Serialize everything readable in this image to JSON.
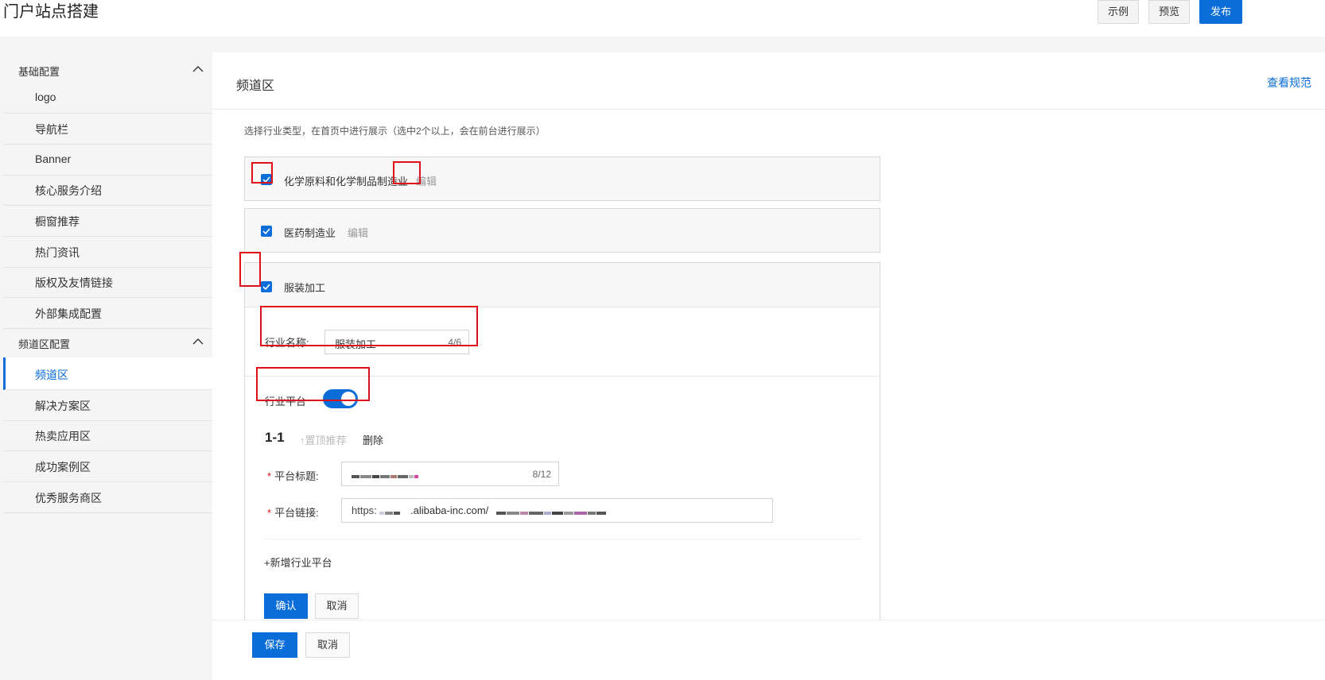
{
  "header": {
    "title": "门户站点搭建",
    "example_label": "示例",
    "preview_label": "预览",
    "publish_label": "发布"
  },
  "sidebar": {
    "group1": {
      "label": "基础配置",
      "items": [
        "logo",
        "导航栏",
        "Banner",
        "核心服务介绍",
        "橱窗推荐",
        "热门资讯",
        "版权及友情链接",
        "外部集成配置"
      ]
    },
    "group2": {
      "label": "频道区配置",
      "items": [
        "频道区",
        "解决方案区",
        "热卖应用区",
        "成功案例区",
        "优秀服务商区"
      ]
    }
  },
  "panel": {
    "title": "频道区",
    "spec_link": "查看规范",
    "hint": "选择行业类型，在首页中进行展示（选中2个以上，会在前台进行展示）",
    "industries": [
      {
        "name": "化学原料和化学制品制造业",
        "edit": "编辑",
        "checked": true
      },
      {
        "name": "医药制造业",
        "edit": "编辑",
        "checked": true
      },
      {
        "name": "服装加工",
        "checked": true
      }
    ],
    "industry_name_label": "行业名称:",
    "industry_name_value": "服装加工",
    "industry_name_count": "4/6",
    "platform_toggle_label": "行业平台",
    "platform_toggle_on": true,
    "platform_index": "1-1",
    "pin_top_label": "↑置顶推荐",
    "delete_label": "删除",
    "platform_title_label": "平台标题:",
    "platform_title_count": "8/12",
    "platform_link_label": "平台链接:",
    "platform_link_prefix": "https:",
    "platform_link_domain": ".alibaba-inc.com/",
    "add_platform_label": "+新增行业平台",
    "confirm_label": "确认",
    "cancel_label": "取消"
  },
  "footer": {
    "save_label": "保存",
    "cancel_label": "取消"
  },
  "colors": {
    "accent": "#0a6dd8",
    "highlight_border": "#e0101a"
  }
}
